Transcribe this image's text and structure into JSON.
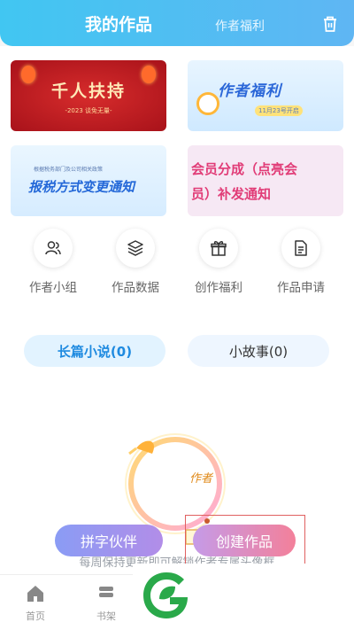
{
  "header": {
    "title": "我的作品",
    "tab_benefits": "作者福利",
    "trash_icon": "trash-icon",
    "accent": "#41c6f2"
  },
  "banners": [
    {
      "title": "千人扶持",
      "subtitle": "-2023 谈免无量-"
    },
    {
      "title": "作者福利",
      "subtitle": "11月23号开启"
    },
    {
      "title": "报税方式变更通知",
      "subtitle": "根据税务部门及公司相关政策"
    },
    {
      "title_line1": "会员分成（点亮会",
      "title_line2": "员）补发通知"
    }
  ],
  "quick_actions": [
    {
      "label": "作者小组",
      "icon": "people-icon"
    },
    {
      "label": "作品数据",
      "icon": "layers-icon"
    },
    {
      "label": "创作福利",
      "icon": "gift-icon"
    },
    {
      "label": "作品申请",
      "icon": "document-icon"
    }
  ],
  "work_tabs": {
    "long_novel": "长篇小说(0)",
    "short_story": "小故事(0)"
  },
  "empty_state": {
    "badge": "作者",
    "tip": "每周保持更新即可解锁作者专属头像框"
  },
  "actions": {
    "partner": "拼字伙伴",
    "create": "创建作品"
  },
  "bottom_nav": [
    {
      "label": "首页",
      "icon": "home-icon"
    },
    {
      "label": "书架",
      "icon": "bookshelf-icon"
    }
  ]
}
